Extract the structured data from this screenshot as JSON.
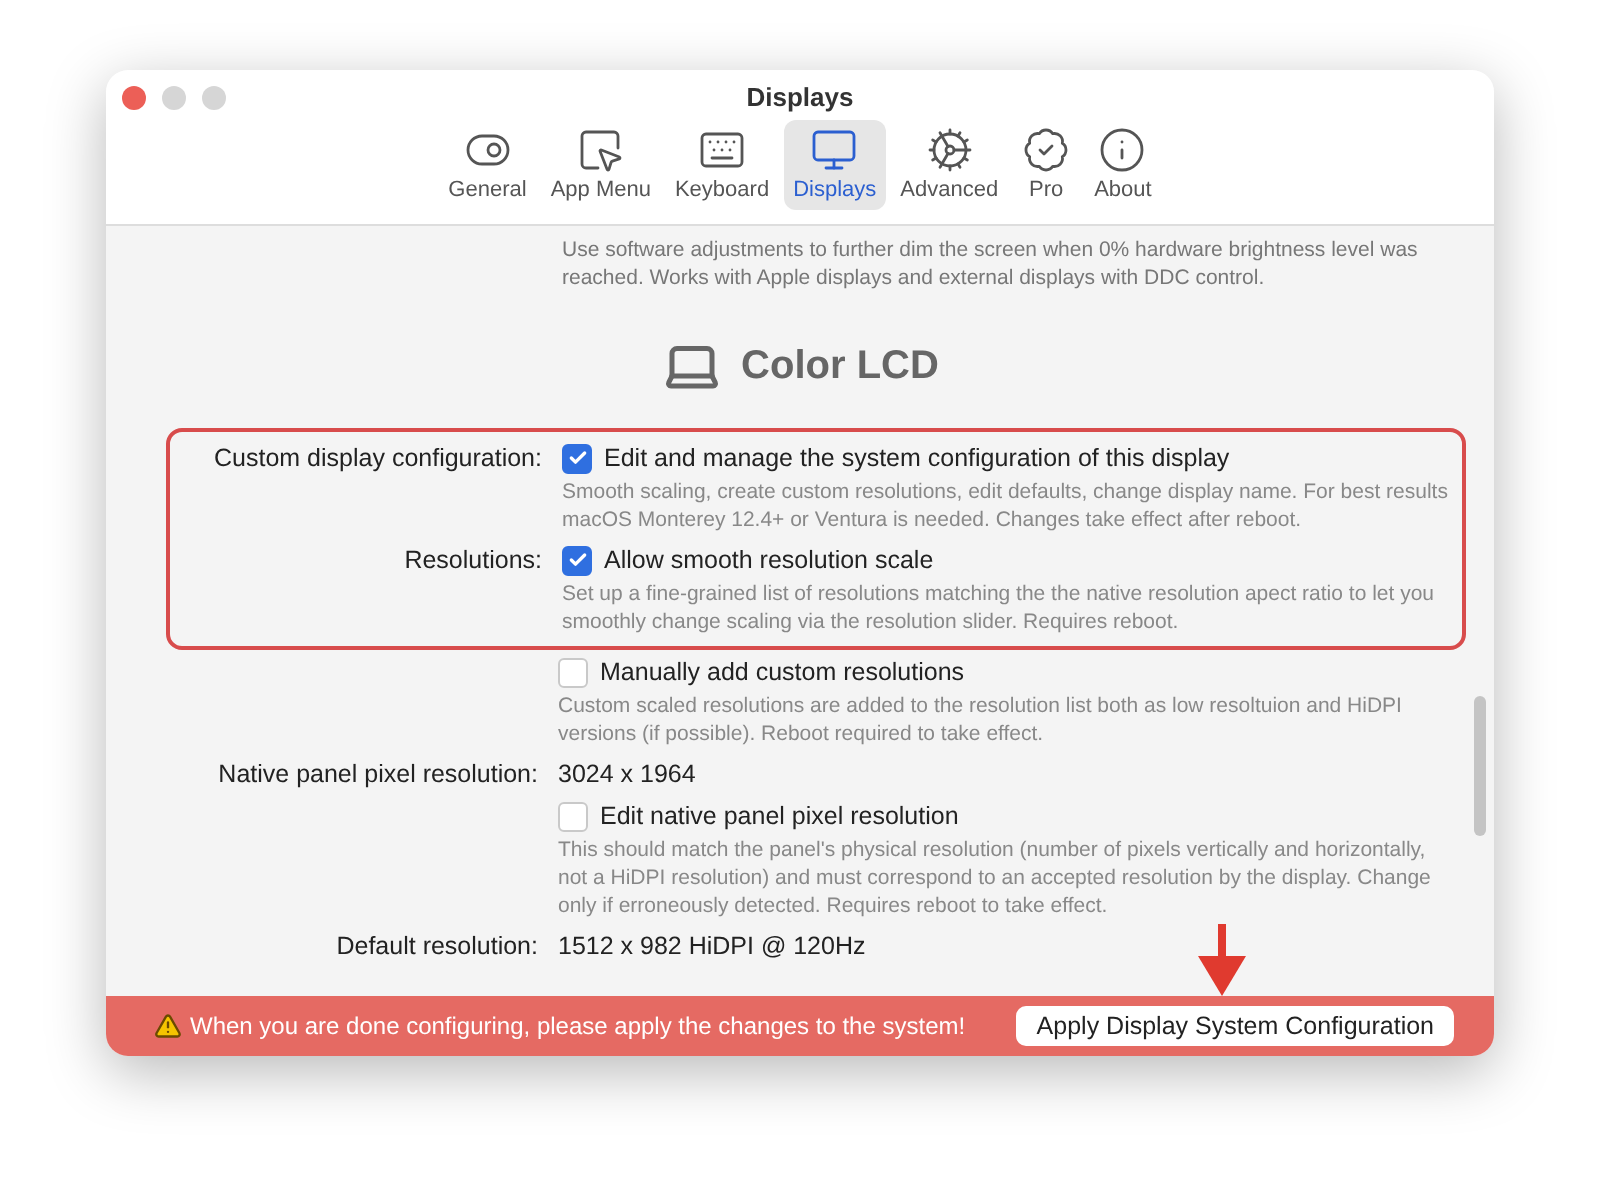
{
  "window": {
    "title": "Displays"
  },
  "toolbar": [
    {
      "label": "General",
      "selected": false
    },
    {
      "label": "App Menu",
      "selected": false
    },
    {
      "label": "Keyboard",
      "selected": false
    },
    {
      "label": "Displays",
      "selected": true
    },
    {
      "label": "Advanced",
      "selected": false
    },
    {
      "label": "Pro",
      "selected": false
    },
    {
      "label": "About",
      "selected": false
    }
  ],
  "intro_text": "Use software adjustments to further dim the screen when 0% hardware brightness level was reached. Works with Apple displays and external displays with DDC control.",
  "display_name": "Color LCD",
  "settings": [
    {
      "kind": "checkbox",
      "highlighted": true,
      "label": "Custom display configuration:",
      "option": "Edit and manage the system configuration of this display",
      "checked": true,
      "description": "Smooth scaling, create custom resolutions, edit defaults, change display name. For best results macOS Monterey 12.4+ or Ventura is needed. Changes take effect after reboot."
    },
    {
      "kind": "checkbox",
      "highlighted": true,
      "label": "Resolutions:",
      "option": "Allow smooth resolution scale",
      "checked": true,
      "description": "Set up a fine-grained list of resolutions matching the the native resolution apect ratio to let you smoothly change scaling via the resolution slider. Requires reboot."
    },
    {
      "kind": "checkbox",
      "highlighted": false,
      "option": "Manually add custom resolutions",
      "checked": false,
      "description": "Custom scaled resolutions are added to the resolution list both as low resoltuion and HiDPI versions (if possible). Reboot required to take effect."
    },
    {
      "kind": "value",
      "highlighted": false,
      "label": "Native panel pixel resolution:",
      "value": "3024 x 1964"
    },
    {
      "kind": "checkbox",
      "highlighted": false,
      "option": "Edit native panel pixel resolution",
      "checked": false,
      "description": "This should match the panel's physical resolution (number of pixels vertically and horizontally, not a HiDPI resolution) and must correspond to an accepted resolution by the display. Change only if erroneously detected. Requires reboot to take effect."
    },
    {
      "kind": "value",
      "highlighted": false,
      "label": "Default resolution:",
      "value": "1512 x 982 HiDPI @ 120Hz"
    }
  ],
  "banner": {
    "message": "When you are done configuring, please apply the changes to the system!",
    "button": "Apply Display System Configuration"
  }
}
